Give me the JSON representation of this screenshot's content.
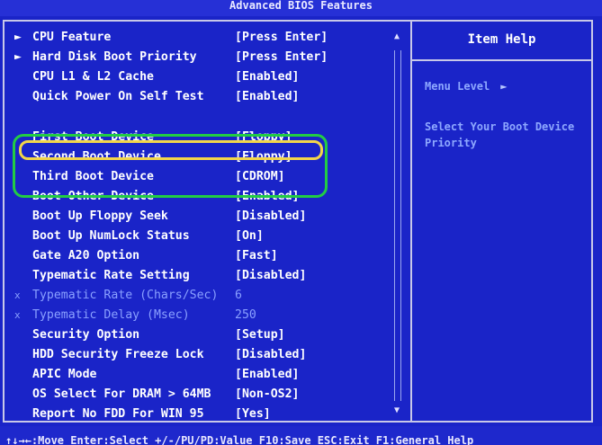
{
  "title": "Advanced BIOS Features",
  "item_help": {
    "title": "Item Help",
    "menu_level_label": "Menu Level",
    "menu_level_arrow": "►",
    "help_text": "Select Your Boot Device Priority"
  },
  "rows": [
    {
      "marker": "►",
      "label": "CPU Feature",
      "value": "[Press Enter]"
    },
    {
      "marker": "►",
      "label": "Hard Disk Boot Priority",
      "value": "[Press Enter]"
    },
    {
      "marker": "",
      "label": "CPU L1 & L2 Cache",
      "value": "[Enabled]"
    },
    {
      "marker": "",
      "label": "Quick Power On Self Test",
      "value": "[Enabled]"
    },
    {
      "marker": "",
      "label": "First Boot Device",
      "value": "[Floppy]"
    },
    {
      "marker": "",
      "label": "Second Boot Device",
      "value": "[Floppy]"
    },
    {
      "marker": "",
      "label": "Third Boot Device",
      "value": "[CDROM]"
    },
    {
      "marker": "",
      "label": "Boot Other Device",
      "value": "[Enabled]"
    },
    {
      "marker": "",
      "label": "Boot Up Floppy Seek",
      "value": "[Disabled]"
    },
    {
      "marker": "",
      "label": "Boot Up NumLock Status",
      "value": "[On]"
    },
    {
      "marker": "",
      "label": "Gate A20 Option",
      "value": "[Fast]"
    },
    {
      "marker": "",
      "label": "Typematic Rate Setting",
      "value": "[Disabled]"
    },
    {
      "marker": "x",
      "label": "Typematic Rate (Chars/Sec)",
      "value": "6"
    },
    {
      "marker": "x",
      "label": "Typematic Delay (Msec)",
      "value": "250"
    },
    {
      "marker": "",
      "label": "Security Option",
      "value": "[Setup]"
    },
    {
      "marker": "",
      "label": "HDD Security Freeze Lock",
      "value": "[Disabled]"
    },
    {
      "marker": "",
      "label": "APIC Mode",
      "value": "[Enabled]"
    },
    {
      "marker": "",
      "label": "OS Select For DRAM > 64MB",
      "value": "[Non-OS2]"
    },
    {
      "marker": "",
      "label": "Report No FDD For WIN 95",
      "value": "[Yes]"
    }
  ],
  "scrollbar": {
    "up": "▲",
    "down": "▼"
  },
  "footer": "↑↓→←:Move  Enter:Select  +/-/PU/PD:Value  F10:Save  ESC:Exit  F1:General Help"
}
